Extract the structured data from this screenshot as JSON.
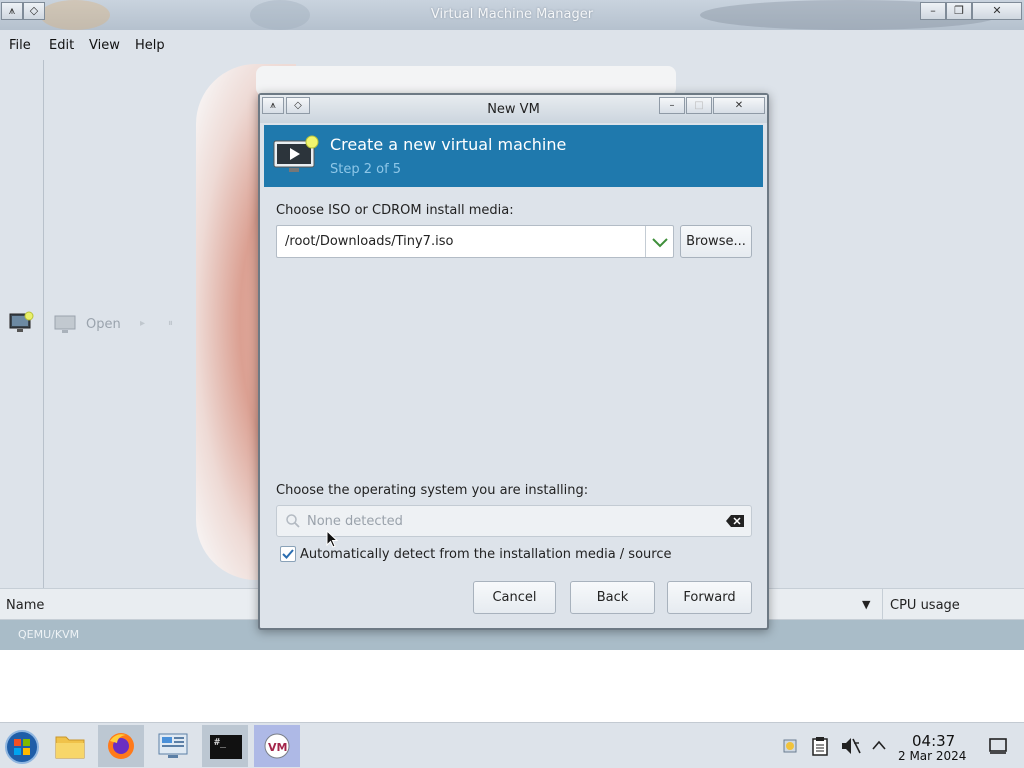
{
  "main_window": {
    "title": "Virtual Machine Manager",
    "titlebar_buttons": {
      "menu_glyph": "⩚",
      "shade_glyph": "◇",
      "minimize": "–",
      "maximize": "❐",
      "close": "✕"
    },
    "menu": [
      "File",
      "Edit",
      "View",
      "Help"
    ],
    "toolbar": {
      "open_label": "Open"
    },
    "list_columns": {
      "name": "Name",
      "cpu": "CPU usage",
      "sort_glyph": "▼"
    },
    "connection": "QEMU/KVM"
  },
  "dialog": {
    "title": "New VM",
    "header_title": "Create a new virtual machine",
    "header_step": "Step 2 of 5",
    "media_label": "Choose ISO or CDROM install media:",
    "media_value": "/root/Downloads/Tiny7.iso",
    "browse_label": "Browse...",
    "os_label": "Choose the operating system you are installing:",
    "os_placeholder": "None detected",
    "auto_detect_label": "Automatically detect from the installation media / source",
    "auto_detect_checked": true,
    "cancel_label": "Cancel",
    "back_label": "Back",
    "forward_label": "Forward"
  },
  "taskbar": {
    "time": "04:37",
    "date": "2 Mar 2024",
    "terminal_glyph": "#_"
  },
  "colors": {
    "header_blue": "#1f79ad",
    "step_text": "#8ec7e8",
    "connection_row": "#a9bcc8"
  }
}
